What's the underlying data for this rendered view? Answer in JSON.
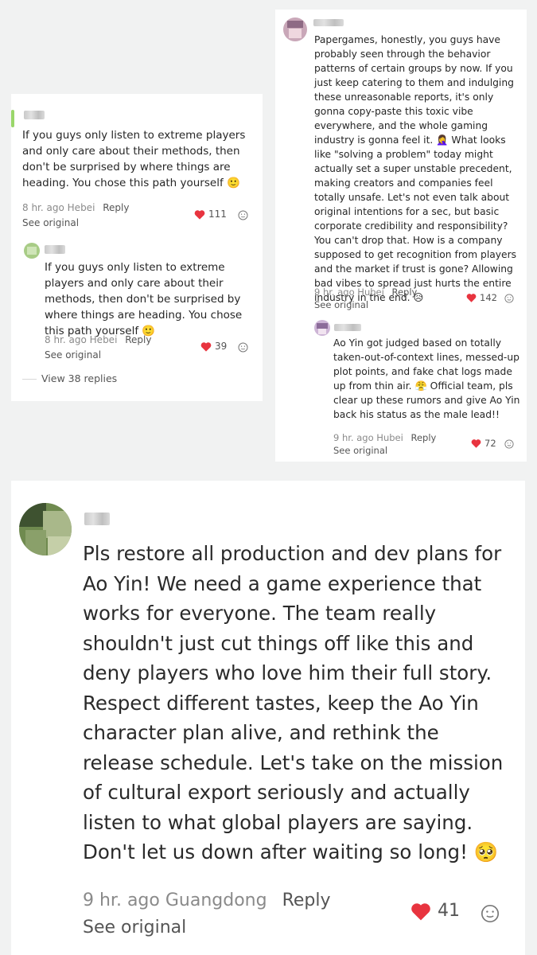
{
  "comments": {
    "a": {
      "text": "If you guys only listen to extreme players and only care about their methods, then don't be surprised by where things are heading. You chose this path yourself",
      "emoji": "🙂",
      "time": "8 hr. ago",
      "location": "Hebei",
      "reply_label": "Reply",
      "see_original": "See original",
      "likes": "111"
    },
    "a_reply": {
      "text": "If you guys only listen to extreme players and only care about their methods, then don't be surprised by where things are heading. You chose this path yourself",
      "emoji": "🙂",
      "time": "8 hr. ago",
      "location": "Hebei",
      "reply_label": "Reply",
      "see_original": "See original",
      "likes": "39"
    },
    "a_view_replies": "View 38 replies",
    "b": {
      "text": "Papergames, honestly, you guys have probably seen through the behavior patterns of certain groups by now. If you just keep catering to them and indulging these unreasonable reports, it's only gonna copy-paste this toxic vibe everywhere, and the whole gaming industry is gonna feel it. 🤦‍♀️ What looks like \"solving a problem\" today might actually set a super unstable precedent, making creators and companies feel totally unsafe. Let's not even talk about original intentions for a sec, but basic corporate credibility and responsibility? You can't drop that. How is a company supposed to get recognition from players and the market if trust is gone? Allowing bad vibes to spread just hurts the entire industry in the end. 😥",
      "time": "9 hr. ago",
      "location": "Hubei",
      "reply_label": "Reply",
      "see_original": "See original",
      "likes": "142"
    },
    "b_reply": {
      "text": "Ao Yin got judged based on totally taken-out-of-context lines, messed-up plot points, and fake chat logs made up from thin air. 😤 Official team, pls clear up these rumors and give Ao Yin back his status as the male lead!!",
      "time": "9 hr. ago",
      "location": "Hubei",
      "reply_label": "Reply",
      "see_original": "See original",
      "likes": "72"
    },
    "c": {
      "text": "Pls restore all production and dev plans for Ao Yin! We need a game experience that works for everyone. The team really shouldn't just cut things off like this and deny players who love him their full story. Respect different tastes, keep the Ao Yin character plan alive, and rethink the release schedule. Let's take on the mission of cultural export seriously and actually listen to what global players are saying. Don't let us down after waiting so long!",
      "emoji": "🥺",
      "time": "9 hr. ago",
      "location": "Guangdong",
      "reply_label": "Reply",
      "see_original": "See original",
      "likes": "41"
    }
  },
  "colors": {
    "heart": "#e8343f",
    "meta": "#8a8a8a",
    "text": "#262626"
  },
  "icons": [
    "heart-icon",
    "react-face-icon",
    "avatar-icon"
  ]
}
